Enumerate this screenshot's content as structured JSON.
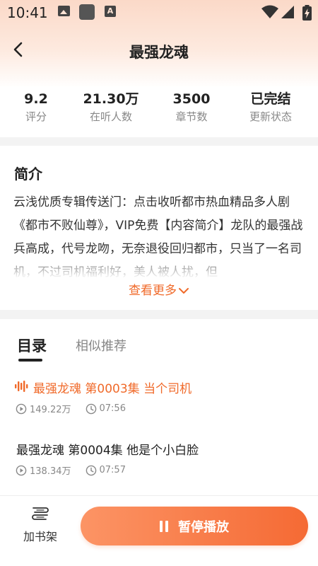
{
  "status_bar": {
    "time": "10:41",
    "a_glyph": "A"
  },
  "header": {
    "title": "最强龙魂"
  },
  "stats": [
    {
      "value": "9.2",
      "label": "评分"
    },
    {
      "value": "21.30万",
      "label": "在听人数"
    },
    {
      "value": "3500",
      "label": "章节数"
    },
    {
      "value": "已完结",
      "label": "更新状态"
    }
  ],
  "intro": {
    "title": "简介",
    "text": "云浅优质专辑传送门：点击收听都市热血精品多人剧《都市不败仙尊》，VIP免费【内容简介】龙队的最强战兵高成，代号龙吻，无奈退役回归都市，只当了一名司机，不过司机福利好，美人被人扰，但",
    "see_more": "查看更多"
  },
  "tabs": {
    "active": "目录",
    "other": "相似推荐"
  },
  "episodes": [
    {
      "title": "最强龙魂 第0003集 当个司机",
      "plays": "149.22万",
      "duration": "07:56",
      "playing": true
    },
    {
      "title": "最强龙魂 第0004集 他是个小白脸",
      "plays": "138.34万",
      "duration": "07:57",
      "playing": false
    }
  ],
  "bottom_bar": {
    "shelf_label": "加书架",
    "pause_label": "暂停播放"
  },
  "colors": {
    "accent": "#f06a2a",
    "header_bg": "#fbd9c8"
  },
  "icons": {
    "back": "chevron-left-icon",
    "see_more": "chevron-down-icon",
    "playing": "sound-wave-icon",
    "plays": "play-circle-icon",
    "duration": "clock-icon",
    "shelf": "bookshelf-icon",
    "pause": "pause-icon"
  }
}
